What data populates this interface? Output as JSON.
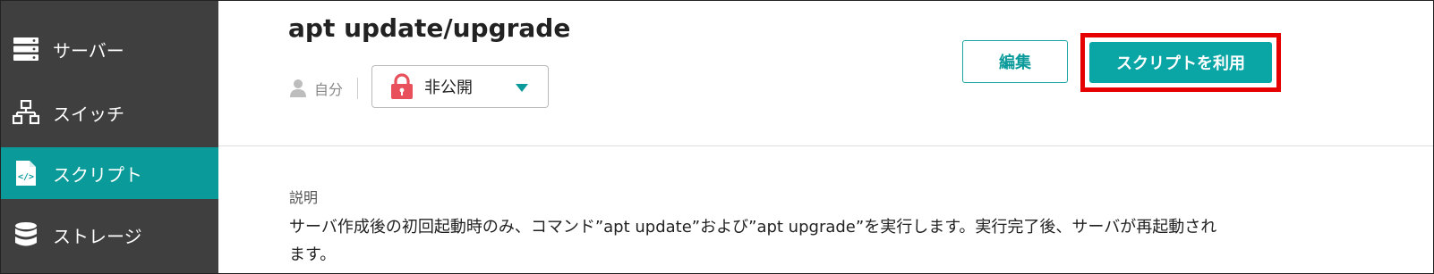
{
  "sidebar": {
    "items": [
      {
        "label": "サーバー",
        "icon": "server-icon",
        "active": false
      },
      {
        "label": "スイッチ",
        "icon": "switch-icon",
        "active": false
      },
      {
        "label": "スクリプト",
        "icon": "script-icon",
        "active": true
      },
      {
        "label": "ストレージ",
        "icon": "storage-icon",
        "active": false
      }
    ],
    "active_color": "#0a9a9a",
    "background": "#3f3f3f"
  },
  "header": {
    "title": "apt update/upgrade",
    "owner": "自分",
    "visibility": {
      "selected": "非公開",
      "icon": "lock-icon"
    },
    "edit_label": "編集",
    "use_label": "スクリプトを利用",
    "accent": "#0aa5a5",
    "highlight_color": "#e60000"
  },
  "description": {
    "label": "説明",
    "text": "サーバ作成後の初回起動時のみ、コマンド”apt update”および”apt upgrade”を実行します。実行完了後、サーバが再起動されます。"
  }
}
